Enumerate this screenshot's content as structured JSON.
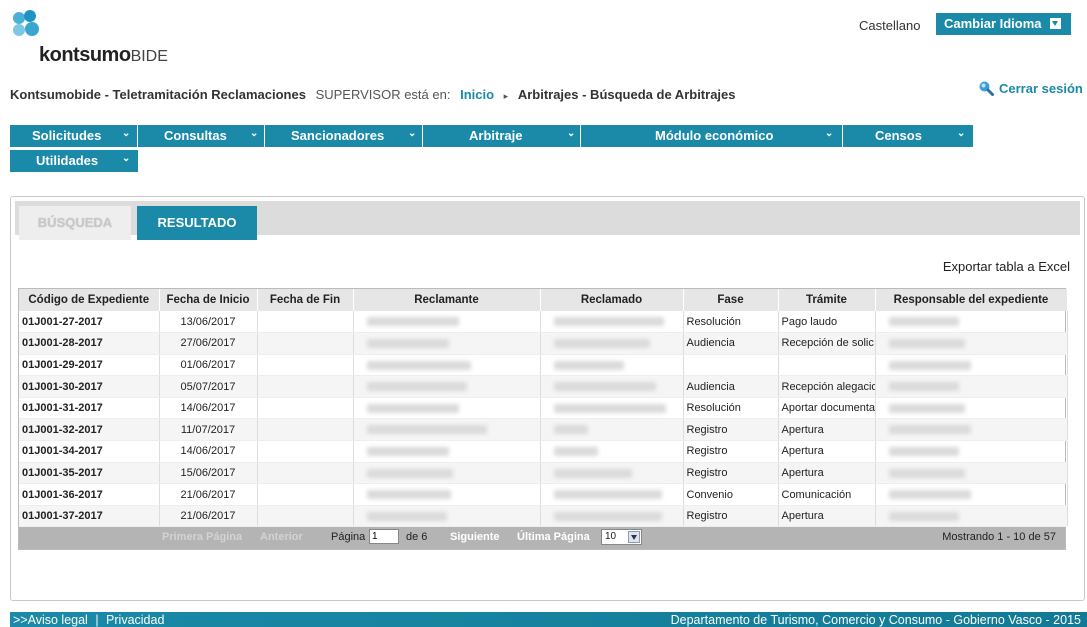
{
  "brand": {
    "name": "kontsumo",
    "suffix": "BIDE"
  },
  "language": {
    "current": "Castellano",
    "button": "Cambiar Idioma"
  },
  "breadcrumb": {
    "app": "Kontsumobide - Teletramitación Reclamaciones",
    "user": "SUPERVISOR está en:",
    "home": "Inicio",
    "current": "Arbitrajes - Búsqueda de Arbitrajes"
  },
  "logout": "Cerrar sesión",
  "nav": [
    {
      "label": "Solicitudes"
    },
    {
      "label": "Consultas"
    },
    {
      "label": "Sancionadores"
    },
    {
      "label": "Arbitraje"
    },
    {
      "label": "Módulo económico"
    },
    {
      "label": "Censos"
    },
    {
      "label": "Utilidades"
    }
  ],
  "tabs": {
    "search": "BÚSQUEDA",
    "result": "RESULTADO"
  },
  "export_label": "Exportar tabla a Excel",
  "table": {
    "columns": [
      "Código de Expediente",
      "Fecha de Inicio",
      "Fecha de Fin",
      "Reclamante",
      "Reclamado",
      "Fase",
      "Trámite",
      "Responsable del expediente"
    ],
    "rows": [
      {
        "code": "01J001-27-2017",
        "start": "13/06/2017",
        "end": "",
        "phase": "Resolución",
        "step": "Pago laudo"
      },
      {
        "code": "01J001-28-2017",
        "start": "27/06/2017",
        "end": "",
        "phase": "Audiencia",
        "step": "Recepción de solic"
      },
      {
        "code": "01J001-29-2017",
        "start": "01/06/2017",
        "end": "",
        "phase": "",
        "step": ""
      },
      {
        "code": "01J001-30-2017",
        "start": "05/07/2017",
        "end": "",
        "phase": "Audiencia",
        "step": "Recepción alegacio"
      },
      {
        "code": "01J001-31-2017",
        "start": "14/06/2017",
        "end": "",
        "phase": "Resolución",
        "step": "Aportar documenta"
      },
      {
        "code": "01J001-32-2017",
        "start": "11/07/2017",
        "end": "",
        "phase": "Registro",
        "step": "Apertura"
      },
      {
        "code": "01J001-34-2017",
        "start": "14/06/2017",
        "end": "",
        "phase": "Registro",
        "step": "Apertura"
      },
      {
        "code": "01J001-35-2017",
        "start": "15/06/2017",
        "end": "",
        "phase": "Registro",
        "step": "Apertura"
      },
      {
        "code": "01J001-36-2017",
        "start": "21/06/2017",
        "end": "",
        "phase": "Convenio",
        "step": "Comunicación"
      },
      {
        "code": "01J001-37-2017",
        "start": "21/06/2017",
        "end": "",
        "phase": "Registro",
        "step": "Apertura"
      }
    ]
  },
  "pager": {
    "first": "Primera Página",
    "prev": "Anterior",
    "page_label": "Página",
    "page_value": "1",
    "of": "de 6",
    "next": "Siguiente",
    "last": "Última Página",
    "page_size": "10",
    "info": "Mostrando 1 - 10 de 57"
  },
  "footer": {
    "legal": ">>Aviso legal",
    "sep": "|",
    "privacy": "Privacidad",
    "department": "Departamento de Turismo, Comercio y Consumo - Gobierno Vasco - 2015"
  },
  "colors": {
    "accent": "#1a8aa8",
    "header_bg": "#e6e6e6",
    "pager_bg": "#b4b4b4"
  }
}
